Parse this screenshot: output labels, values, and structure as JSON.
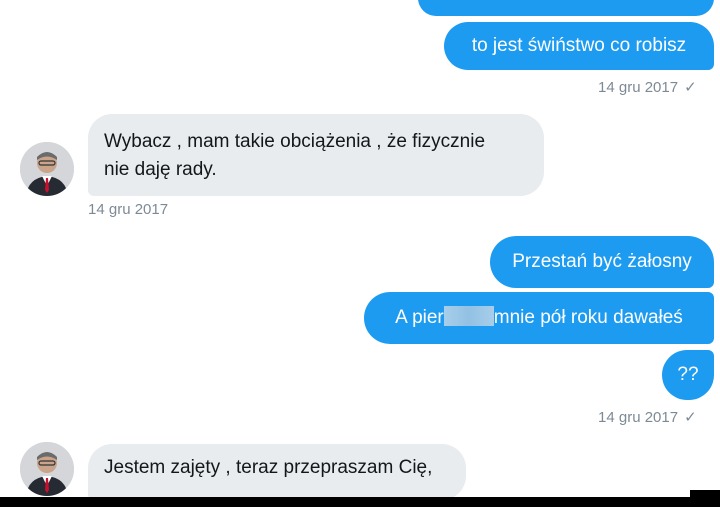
{
  "colors": {
    "outgoing_bubble": "#1d9bf0",
    "incoming_bubble": "#e8ecef",
    "timestamp": "#7d8a96"
  },
  "messages": {
    "top_partial": "",
    "m1": "to jest świństwo co robisz",
    "t1": "14 gru 2017",
    "m2_line1": "Wybacz , mam takie obciążenia , że fizycznie",
    "m2_line2": "nie daję rady.",
    "t2": "14 gru 2017",
    "m3": "Przestań być żałosny",
    "m4_before": "A pier",
    "m4_after": "mnie pół roku dawałeś",
    "m5": "??",
    "t3": "14 gru 2017",
    "m6": "Jestem zajęty , teraz przepraszam Cię,"
  },
  "icons": {
    "read_check": "✓",
    "avatar": "avatar-icon"
  }
}
